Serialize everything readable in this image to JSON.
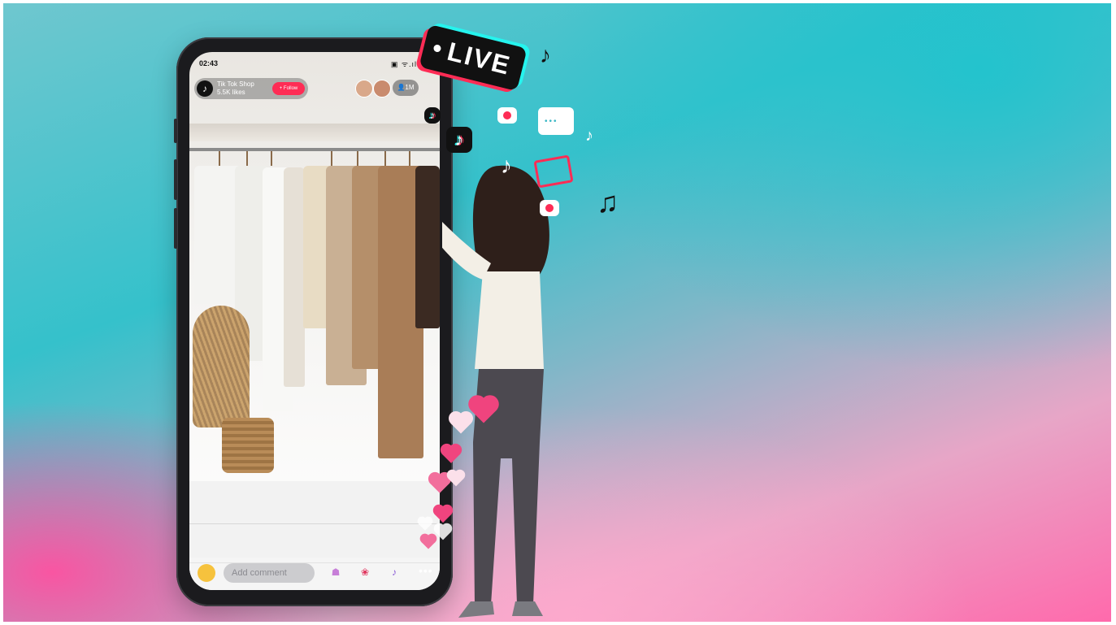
{
  "status_bar": {
    "time": "02:43",
    "indicators": "▣ ᯤ.ıl ◐"
  },
  "live_header": {
    "shop_name": "Tik Tok Shop",
    "likes": "5.5K likes",
    "follow_label": "+ Follow",
    "viewer_count": "👤1M"
  },
  "live_badge": {
    "label": "LIVE"
  },
  "comment_bar": {
    "placeholder": "Add comment",
    "more": "•••"
  },
  "icons": {
    "shop_logo": "tiktok-icon",
    "viewers": "person-icon",
    "bottom": [
      "gift-icon",
      "rose-icon",
      "tiktok-icon",
      "more-icon"
    ]
  },
  "colors": {
    "accent_pink": "#fe2c55",
    "accent_cyan": "#25f4ee",
    "background_teal": "#35c1cb",
    "background_pink": "#ff6aac"
  }
}
